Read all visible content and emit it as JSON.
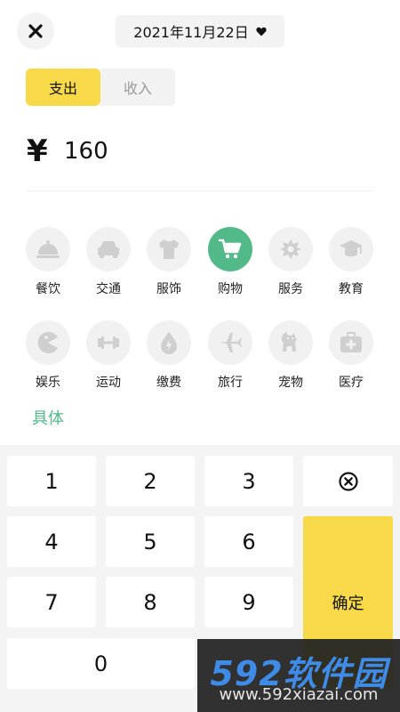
{
  "header": {
    "date_label": "2021年11月22日"
  },
  "type_tabs": {
    "expense": "支出",
    "income": "收入"
  },
  "amount": {
    "currency": "¥",
    "value": "160"
  },
  "categories": [
    {
      "label": "餐饮",
      "icon": "cloche-icon"
    },
    {
      "label": "交通",
      "icon": "car-icon"
    },
    {
      "label": "服饰",
      "icon": "tshirt-icon"
    },
    {
      "label": "购物",
      "icon": "cart-icon",
      "selected": true
    },
    {
      "label": "服务",
      "icon": "service-icon"
    },
    {
      "label": "教育",
      "icon": "graduation-cap-icon"
    },
    {
      "label": "娱乐",
      "icon": "pacman-icon"
    },
    {
      "label": "运动",
      "icon": "dumbbell-icon"
    },
    {
      "label": "缴费",
      "icon": "water-drop-icon"
    },
    {
      "label": "旅行",
      "icon": "airplane-icon"
    },
    {
      "label": "宠物",
      "icon": "dog-icon"
    },
    {
      "label": "医疗",
      "icon": "medkit-icon"
    }
  ],
  "detail_link": "具体",
  "keypad": {
    "k1": "1",
    "k2": "2",
    "k3": "3",
    "k4": "4",
    "k5": "5",
    "k6": "6",
    "k7": "7",
    "k8": "8",
    "k9": "9",
    "k0": "0",
    "confirm": "确定",
    "delete_icon": "delete-icon"
  },
  "watermark": {
    "line1": "592软件园",
    "line2": "www.592xiazai.com"
  },
  "colors": {
    "accent_yellow": "#f8d94a",
    "accent_green": "#52b989",
    "icon_gray": "#cfcfcf"
  }
}
